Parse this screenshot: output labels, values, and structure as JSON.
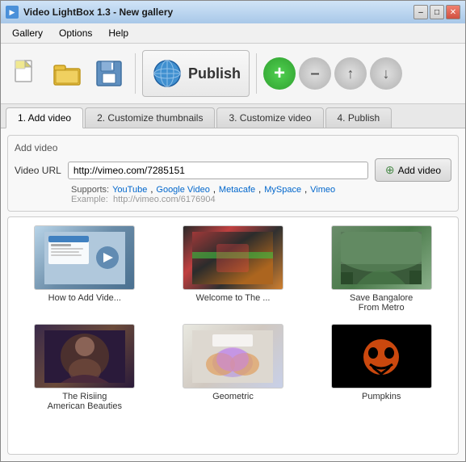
{
  "window": {
    "title": "Video LightBox 1.3  -  New gallery",
    "icon": "▶"
  },
  "title_buttons": {
    "minimize": "–",
    "maximize": "□",
    "close": "✕"
  },
  "menu": {
    "items": [
      "Gallery",
      "Options",
      "Help"
    ]
  },
  "toolbar": {
    "new_label": "",
    "open_label": "",
    "save_label": "",
    "publish_label": "Publish"
  },
  "tabs": [
    {
      "id": "add-video",
      "label": "1. Add video",
      "active": true
    },
    {
      "id": "customize-thumbnails",
      "label": "2. Customize thumbnails",
      "active": false
    },
    {
      "id": "customize-video",
      "label": "3. Customize video",
      "active": false
    },
    {
      "id": "publish",
      "label": "4. Publish",
      "active": false
    }
  ],
  "add_video_group": {
    "title": "Add video",
    "url_label": "Video URL",
    "url_value": "http://vimeo.com/7285151",
    "supports_label": "Supports:",
    "supports_links": [
      "YouTube",
      "Google Video",
      "Metacafe",
      "MySpace",
      "Vimeo"
    ],
    "example_label": "Example:",
    "example_url": "http://vimeo.com/6176904",
    "add_button_label": "Add video",
    "add_button_icon": "+"
  },
  "videos": [
    {
      "id": 1,
      "title": "How to Add Vide...",
      "thumb_class": "thumb-1"
    },
    {
      "id": 2,
      "title": "Welcome to The ...",
      "thumb_class": "thumb-2"
    },
    {
      "id": 3,
      "title": "Save Bangalore\nFrom Metro",
      "thumb_class": "thumb-3"
    },
    {
      "id": 4,
      "title": "The Risiing\nAmerican Beauties",
      "thumb_class": "thumb-4"
    },
    {
      "id": 5,
      "title": "Geometric",
      "thumb_class": "thumb-5"
    },
    {
      "id": 6,
      "title": "Pumpkins",
      "thumb_class": "thumb-6"
    }
  ],
  "round_buttons": {
    "add": "+",
    "remove": "–",
    "up": "↑",
    "down": "↓"
  }
}
